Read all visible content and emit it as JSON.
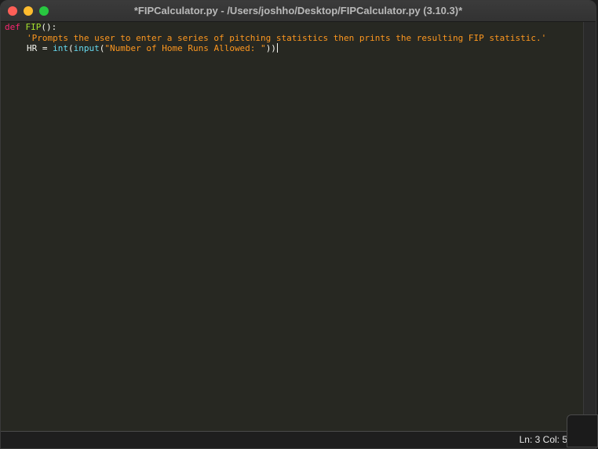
{
  "window": {
    "title": "*FIPCalculator.py - /Users/joshho/Desktop/FIPCalculator.py (3.10.3)*"
  },
  "code": {
    "line1": {
      "keyword": "def",
      "space": " ",
      "function_name": "FIP",
      "rest": "():"
    },
    "line2": {
      "docstring": "'Prompts the user to enter a series of pitching statistics then prints the resulting FIP statistic.'"
    },
    "line3": {
      "var": "HR = ",
      "builtin_int": "int",
      "paren_open": "(",
      "builtin_input": "input",
      "paren_open2": "(",
      "string": "\"Number of Home Runs Allowed: \"",
      "paren_close": "))"
    }
  },
  "status": {
    "text": "Ln: 3   Col: 5"
  },
  "colors": {
    "background": "#272822",
    "keyword": "#f92672",
    "function": "#a6e22e",
    "string": "#fd971f",
    "builtin": "#66d9ef",
    "text": "#f8f8f2"
  }
}
